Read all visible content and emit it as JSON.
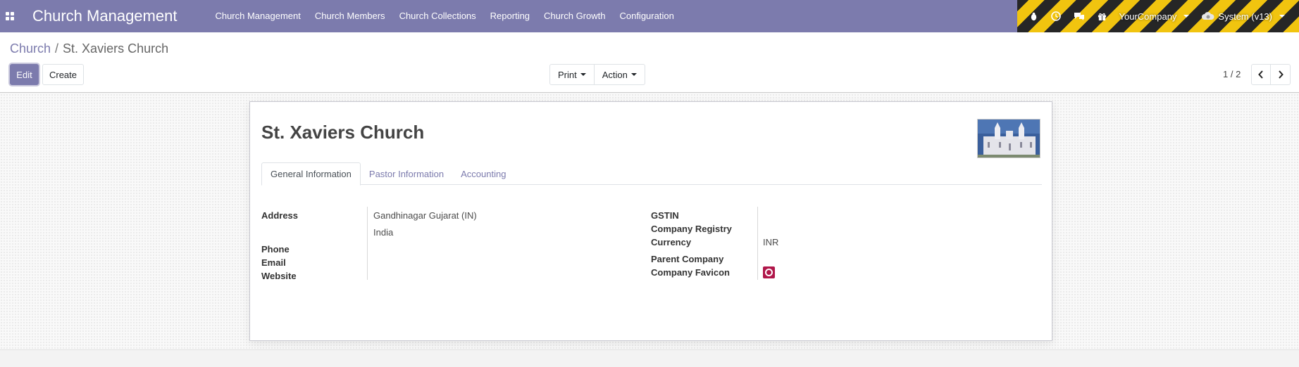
{
  "navbar": {
    "brand": "Church Management",
    "menu": [
      "Church Management",
      "Church Members",
      "Church Collections",
      "Reporting",
      "Church Growth",
      "Configuration"
    ],
    "systray": {
      "company": "YourCompany",
      "user": "System (v13)"
    },
    "colors": {
      "navbar": "#7c7bad"
    }
  },
  "breadcrumb": {
    "parent": "Church",
    "separator": "/",
    "current": "St. Xaviers Church"
  },
  "toolbar": {
    "edit_label": "Edit",
    "create_label": "Create",
    "print_label": "Print",
    "action_label": "Action"
  },
  "pager": {
    "value": "1 / 2"
  },
  "record": {
    "title": "St. Xaviers Church",
    "tabs": [
      "General Information",
      "Pastor Information",
      "Accounting"
    ],
    "left_fields": {
      "address_label": "Address",
      "address_line1": "Gandhinagar  Gujarat (IN)",
      "address_line2": "India",
      "phone_label": "Phone",
      "email_label": "Email",
      "website_label": "Website"
    },
    "right_fields": {
      "gstin_label": "GSTIN",
      "company_registry_label": "Company Registry",
      "currency_label": "Currency",
      "currency_value": "INR",
      "parent_company_label": "Parent Company",
      "company_favicon_label": "Company Favicon"
    }
  }
}
